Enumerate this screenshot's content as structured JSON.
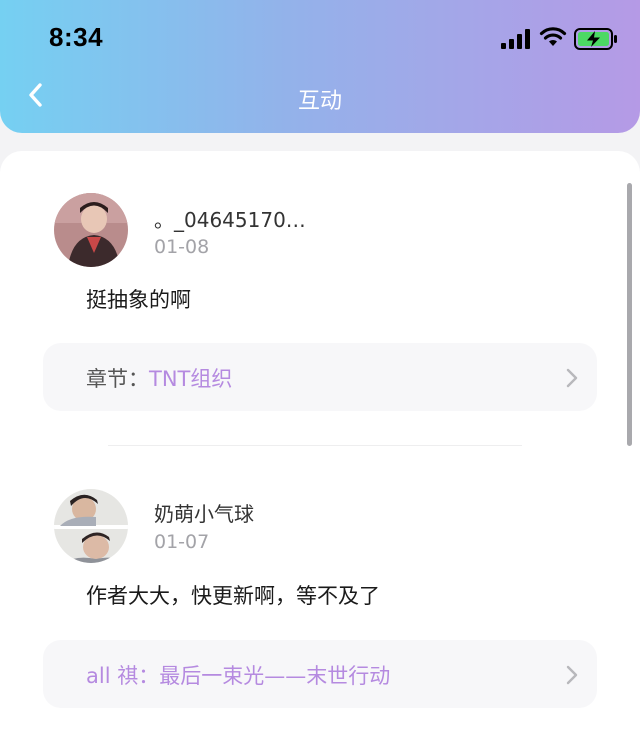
{
  "status_bar": {
    "time": "8:34",
    "icons": [
      "cellular-signal-icon",
      "wifi-icon",
      "battery-charging-icon"
    ]
  },
  "nav": {
    "title": "互动",
    "back_icon": "chevron-left-icon"
  },
  "colors": {
    "header_gradient_start": "#75d0f2",
    "header_gradient_end": "#b59ae6",
    "chapter_link": "#b58ae0",
    "battery_fill": "#4cd964"
  },
  "comments": [
    {
      "username": "。_04645170…",
      "date": "01-08",
      "content": "挺抽象的啊",
      "chapter_prefix": "章节：",
      "chapter_name": "TNT组织"
    },
    {
      "username": "奶萌小气球",
      "date": "01-07",
      "content": "作者大大，快更新啊，等不及了",
      "chapter_prefix": "",
      "chapter_name": "all 祺：最后一束光——末世行动"
    }
  ]
}
